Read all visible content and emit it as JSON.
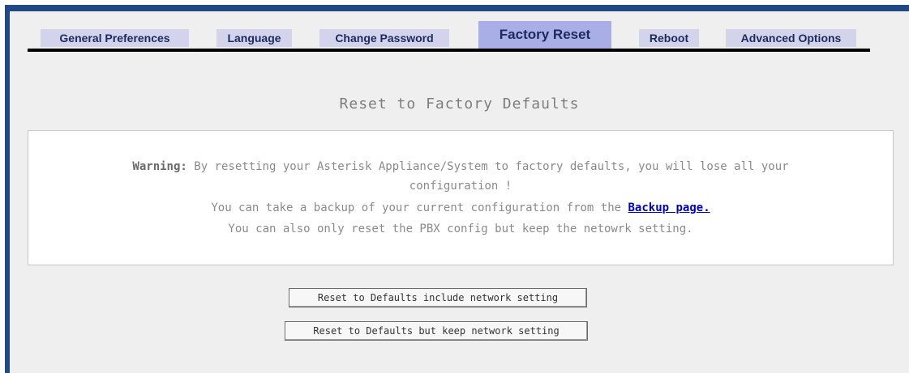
{
  "tabs": [
    {
      "label": "General Preferences"
    },
    {
      "label": "Language"
    },
    {
      "label": "Change Password"
    },
    {
      "label": "Factory Reset"
    },
    {
      "label": "Reboot"
    },
    {
      "label": "Advanced Options"
    }
  ],
  "active_tab": "Factory Reset",
  "title": "Reset to Factory Defaults",
  "warning": {
    "label": "Warning:",
    "text1": " By resetting your Asterisk Appliance/System to factory defaults, you will lose all your",
    "text2": "configuration !",
    "backup_prefix": "You can take a backup of your current configuration from the ",
    "backup_link": "Backup page.",
    "text4": "You can also only reset the PBX config but keep the netowrk setting."
  },
  "buttons": {
    "reset_include": "Reset to Defaults include network setting",
    "reset_keep": "Reset to Defaults but keep network setting"
  },
  "colors": {
    "border": "#1f4a86",
    "tab_bg": "#d3d3ec",
    "tab_active_bg": "#a9aee7",
    "link": "#0000cc"
  }
}
